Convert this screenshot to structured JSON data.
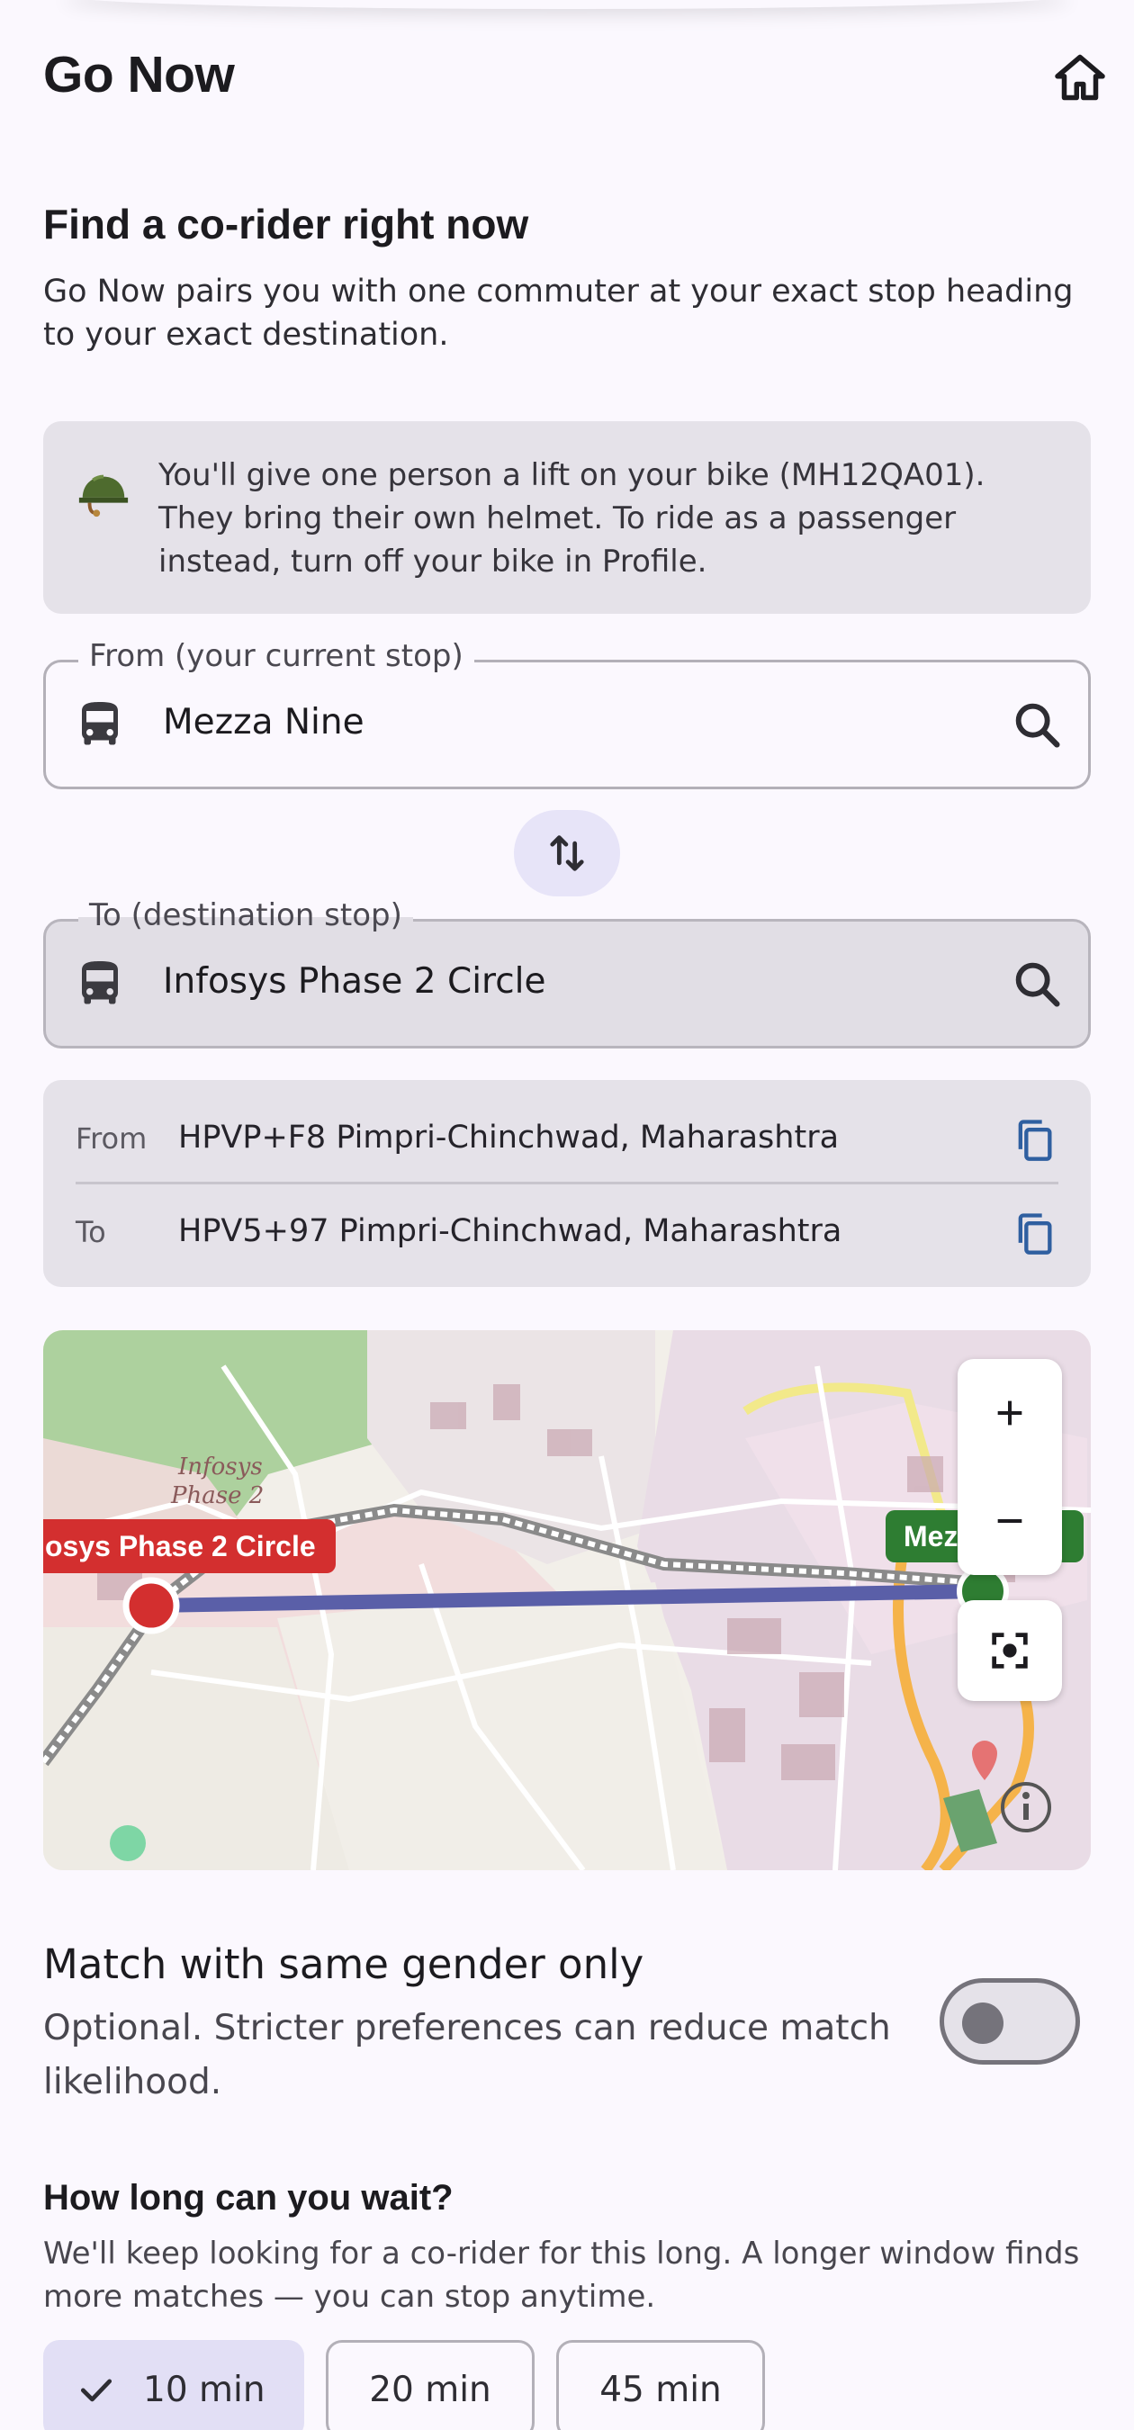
{
  "app": {
    "title": "Go Now"
  },
  "header": {
    "home_icon": "home-icon"
  },
  "intro": {
    "heading": "Find a co-rider right now",
    "description": "Go Now pairs you with one commuter at your exact stop heading to your exact destination."
  },
  "info": {
    "icon": "helmet-icon",
    "text": "You'll give one person a lift on your bike (MH12QA01). They bring their own helmet. To ride as a passenger instead, turn off your bike in Profile."
  },
  "from_field": {
    "label": "From (your current stop)",
    "value": "Mezza Nine",
    "icon": "bus-icon"
  },
  "to_field": {
    "label": "To (destination stop)",
    "value": "Infosys Phase 2 Circle",
    "icon": "bus-icon"
  },
  "addresses": {
    "from_key": "From",
    "from_value": "HPVP+F8 Pimpri-Chinchwad, Maharashtra",
    "to_key": "To",
    "to_value": "HPV5+97 Pimpri-Chinchwad, Maharashtra"
  },
  "map": {
    "dest_label": "osys Phase 2 Circle",
    "origin_label": "Mez",
    "area_label_line1": "Infosys",
    "area_label_line2": "Phase 2",
    "route_color": "#5A5FA8",
    "zoom_in": "+",
    "zoom_out": "−"
  },
  "gender": {
    "title": "Match with same gender only",
    "subtitle": "Optional. Stricter preferences can reduce match likelihood.",
    "enabled": false
  },
  "wait": {
    "title": "How long can you wait?",
    "subtitle": "We'll keep looking for a co-rider for this long. A longer window finds more matches — you can stop anytime.",
    "options": [
      "10 min",
      "20 min",
      "45 min"
    ],
    "selected": "10 min"
  },
  "colors": {
    "background": "#FBF8FE",
    "card": "#E5E2E9",
    "accent": "#E2DFF5",
    "red": "#D32F2F",
    "green": "#2E7D32"
  }
}
